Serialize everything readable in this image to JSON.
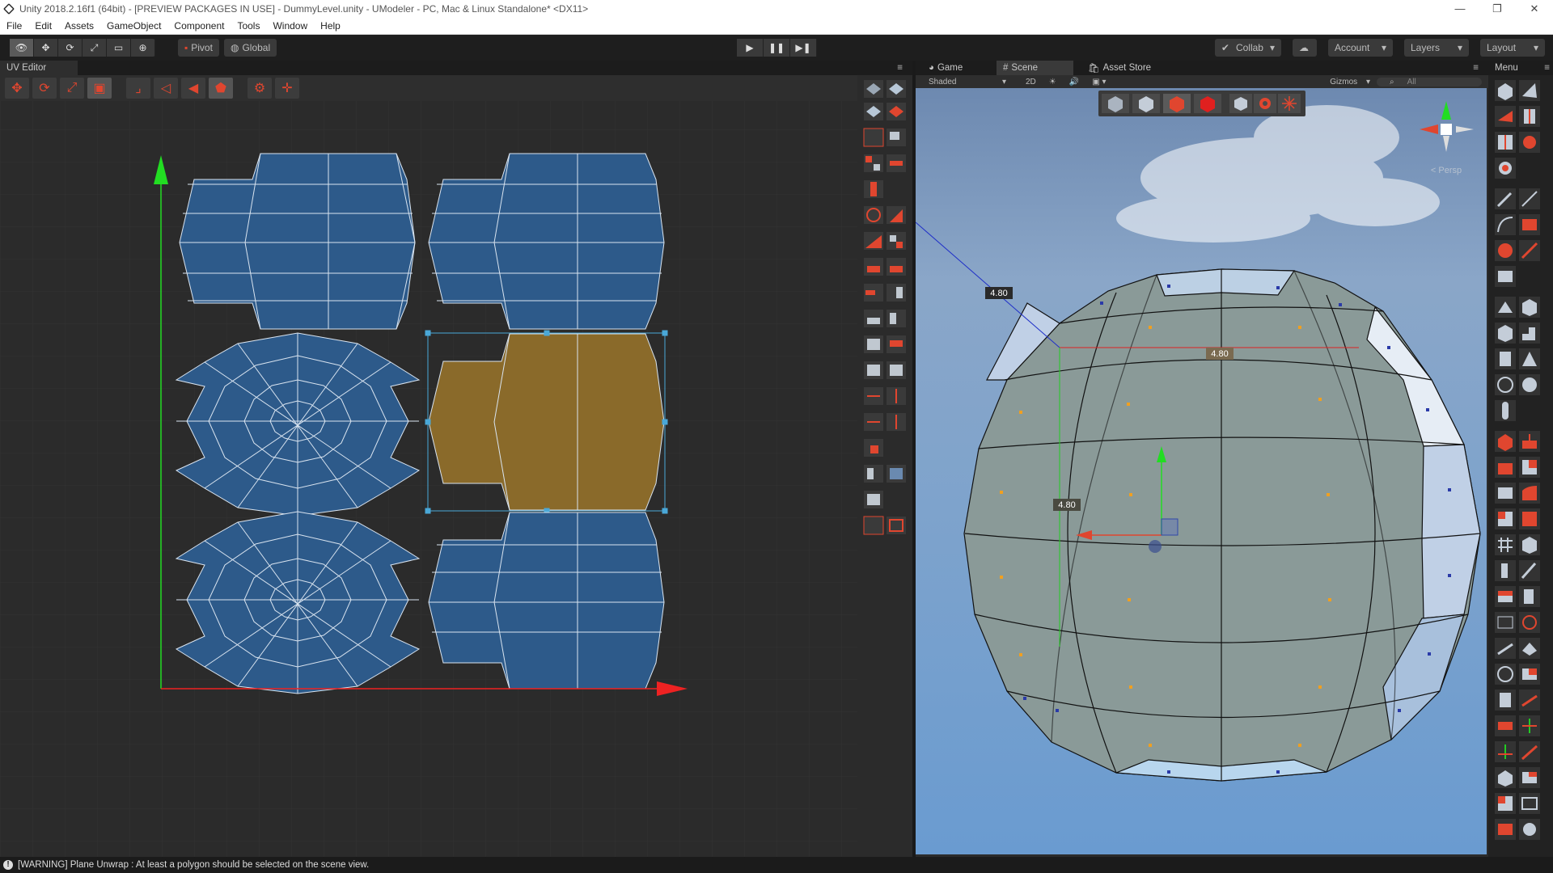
{
  "window": {
    "title": "Unity 2018.2.16f1 (64bit) - [PREVIEW PACKAGES IN USE] - DummyLevel.unity - UModeler - PC, Mac & Linux Standalone* <DX11>",
    "min": "—",
    "max": "❐",
    "close": "✕"
  },
  "menu": [
    "File",
    "Edit",
    "Assets",
    "GameObject",
    "Component",
    "Tools",
    "Window",
    "Help"
  ],
  "toolbar": {
    "pivot": "Pivot",
    "global": "Global",
    "collab": "Collab",
    "account": "Account",
    "layers": "Layers",
    "layout": "Layout"
  },
  "uv_editor": {
    "tab": "UV Editor"
  },
  "scene": {
    "tabs": {
      "game": "Game",
      "scene": "Scene",
      "asset_store": "Asset Store"
    },
    "shading": "Shaded",
    "mode_2d": "2D",
    "gizmos": "Gizmos",
    "search_placeholder": "All",
    "persp": "< Persp",
    "dim_top": "4.80",
    "dim_center": "4.80",
    "dim_left": "4.80"
  },
  "menu_panel": {
    "title": "Menu"
  },
  "status": {
    "message": "[WARNING] Plane Unwrap : At least a polygon should be selected on the scene view."
  },
  "colors": {
    "uv_blue": "#2d5a8a",
    "uv_selected": "#8a6a2a",
    "accent_red": "#e0462f",
    "axis_green": "#22dd22",
    "axis_red": "#ee2222"
  }
}
